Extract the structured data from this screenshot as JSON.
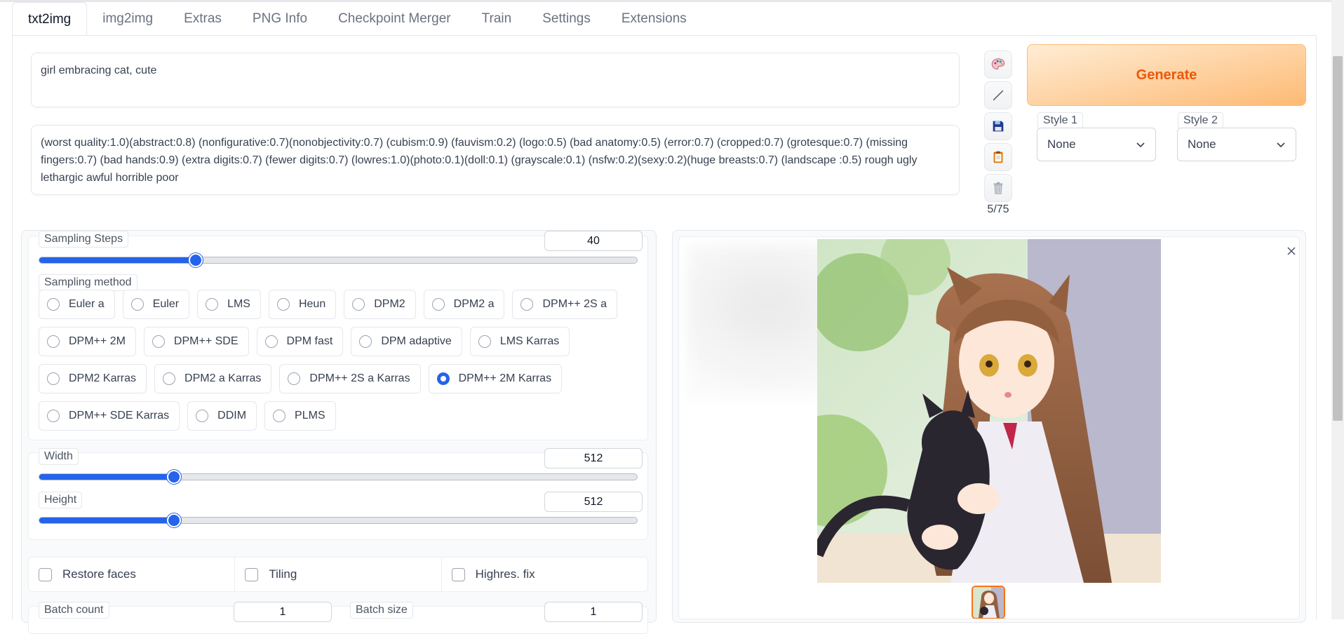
{
  "tabs": [
    {
      "label": "txt2img",
      "active": true
    },
    {
      "label": "img2img"
    },
    {
      "label": "Extras"
    },
    {
      "label": "PNG Info"
    },
    {
      "label": "Checkpoint Merger"
    },
    {
      "label": "Train"
    },
    {
      "label": "Settings"
    },
    {
      "label": "Extensions"
    }
  ],
  "prompt": {
    "text": "girl embracing cat, cute"
  },
  "negative_prompt": {
    "text": "(worst quality:1.0)(abstract:0.8) (nonfigurative:0.7)(nonobjectivity:0.7) (cubism:0.9) (fauvism:0.2) (logo:0.5) (bad anatomy:0.5) (error:0.7) (cropped:0.7) (grotesque:0.7) (missing fingers:0.7) (bad hands:0.9) (extra digits:0.7) (fewer digits:0.7) (lowres:1.0)(photo:0.1)(doll:0.1) (grayscale:0.1) (nsfw:0.2)(sexy:0.2)(huge breasts:0.7) (landscape :0.5) rough ugly lethargic awful horrible poor"
  },
  "tools": {
    "icons": [
      "palette-icon",
      "pencil-icon",
      "save-icon",
      "clipboard-icon",
      "trash-icon"
    ],
    "token_counter": "5/75"
  },
  "generate": {
    "label": "Generate"
  },
  "styles": [
    {
      "label": "Style 1",
      "value": "None"
    },
    {
      "label": "Style 2",
      "value": "None"
    }
  ],
  "sampling_steps": {
    "label": "Sampling Steps",
    "value": "40",
    "min": 1,
    "max": 150
  },
  "sampling_method": {
    "label": "Sampling method",
    "selected": "DPM++ 2M Karras",
    "rows": [
      [
        "Euler a",
        "Euler",
        "LMS",
        "Heun",
        "DPM2",
        "DPM2 a",
        "DPM++ 2S a"
      ],
      [
        "DPM++ 2M",
        "DPM++ SDE",
        "DPM fast",
        "DPM adaptive",
        "LMS Karras"
      ],
      [
        "DPM2 Karras",
        "DPM2 a Karras",
        "DPM++ 2S a Karras",
        "DPM++ 2M Karras"
      ],
      [
        "DPM++ SDE Karras",
        "DDIM",
        "PLMS"
      ]
    ]
  },
  "width": {
    "label": "Width",
    "value": "512",
    "min": 64,
    "max": 2048
  },
  "height": {
    "label": "Height",
    "value": "512",
    "min": 64,
    "max": 2048
  },
  "checkboxes": {
    "restore_faces": {
      "label": "Restore faces",
      "checked": false
    },
    "tiling": {
      "label": "Tiling",
      "checked": false
    },
    "highres_fix": {
      "label": "Highres. fix",
      "checked": false
    }
  },
  "batch_count": {
    "label": "Batch count",
    "value": "1"
  },
  "batch_size": {
    "label": "Batch size",
    "value": "1"
  },
  "colors": {
    "accent": "#2563eb",
    "generate_text": "#ea580c",
    "generate_bg": "#fdba74"
  }
}
